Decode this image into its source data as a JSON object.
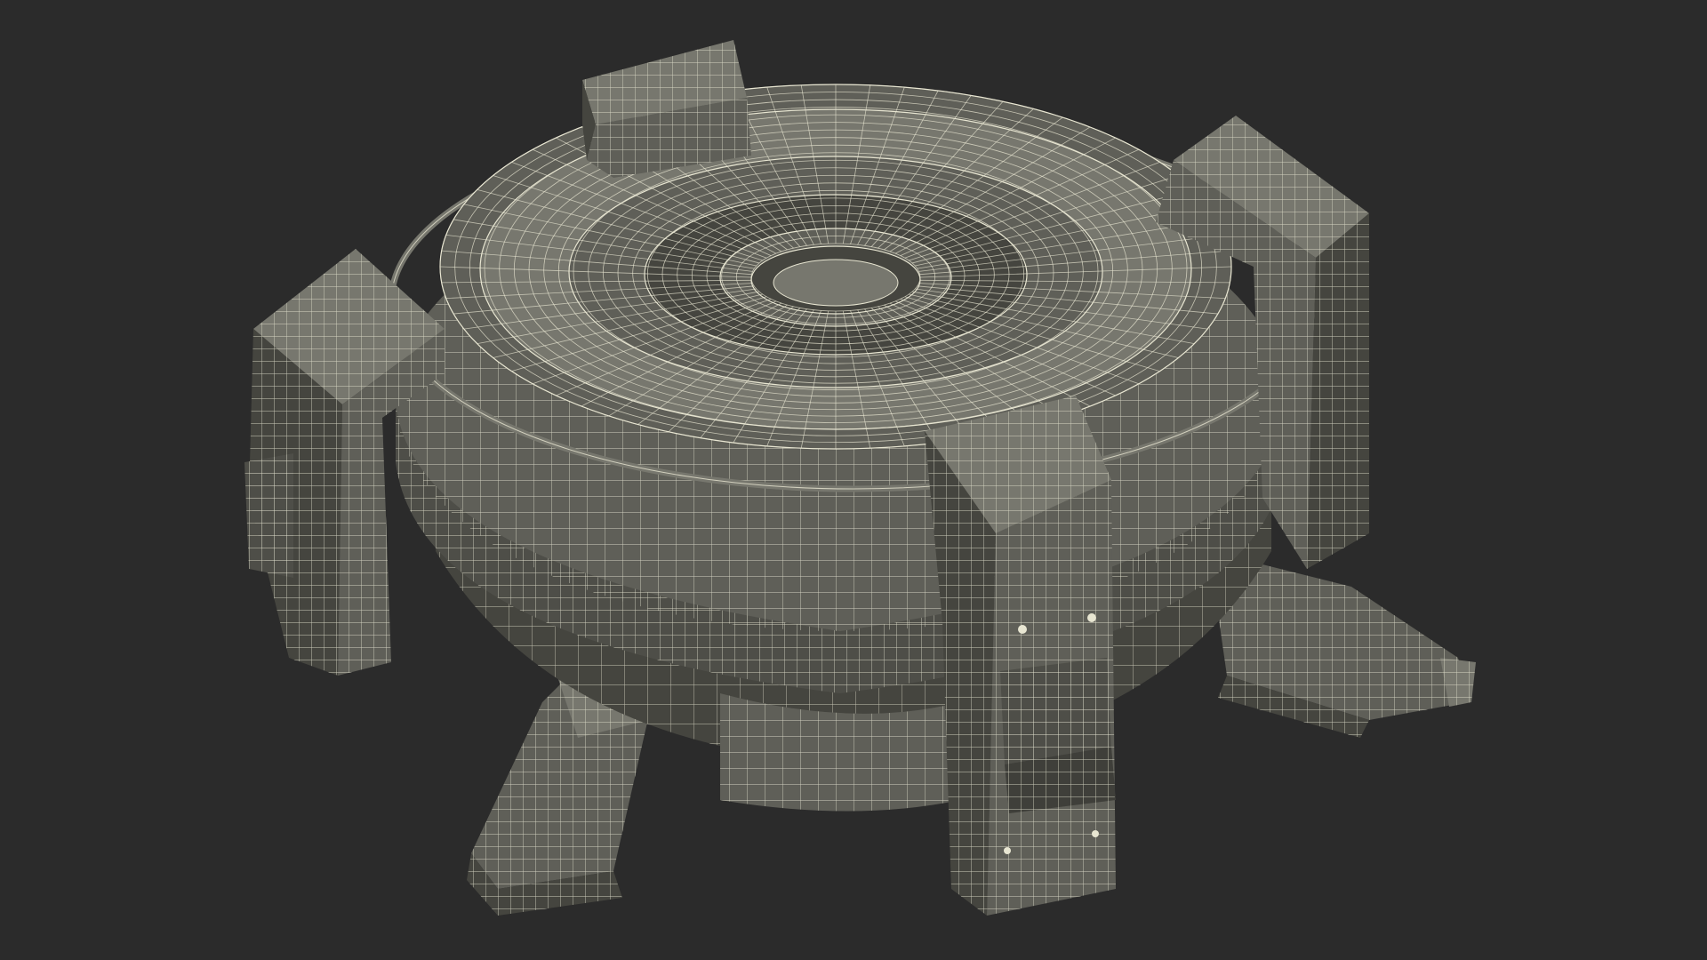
{
  "viewport": {
    "background": "#2b2b2b"
  },
  "model": {
    "subject": "sci-fi-circular-platform-wireframe",
    "shading": "flat-grey",
    "wire_color": "#e8e6d2",
    "surface_color": "#5f5f58",
    "surface_dark": "#45453f",
    "surface_light": "#77776e",
    "pylon_count": 4,
    "base_arm_count": 3
  }
}
